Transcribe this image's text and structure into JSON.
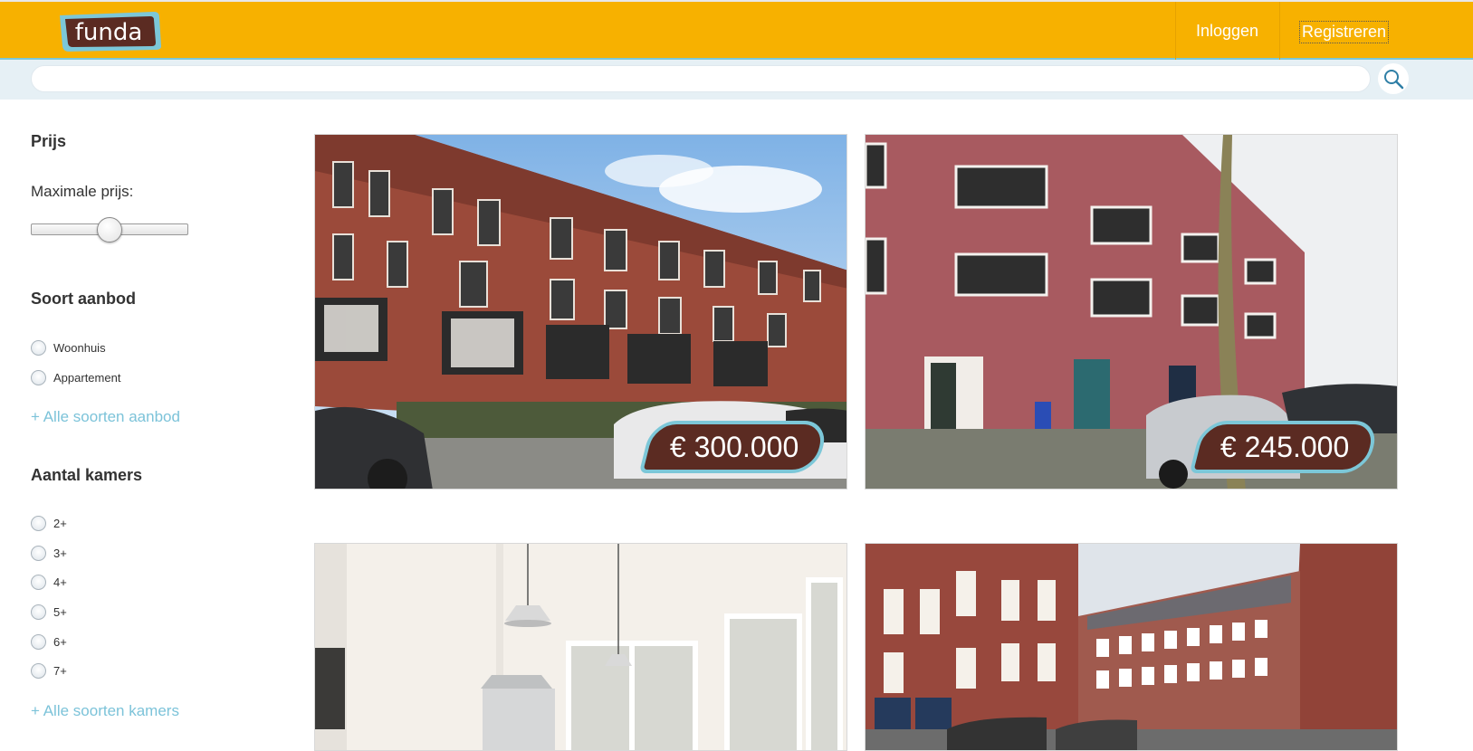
{
  "header": {
    "logo_text": "funda",
    "login_label": "Inloggen",
    "register_label": "Registreren"
  },
  "search": {
    "value": "",
    "placeholder": ""
  },
  "filters": {
    "price": {
      "heading": "Prijs",
      "max_label": "Maximale prijs:",
      "slider_level": 0.5
    },
    "offer_type": {
      "heading": "Soort aanbod",
      "options": [
        "Woonhuis",
        "Appartement"
      ],
      "more_link": "+ Alle soorten aanbod"
    },
    "rooms": {
      "heading": "Aantal kamers",
      "options": [
        "2+",
        "3+",
        "4+",
        "5+",
        "6+",
        "7+"
      ],
      "more_link": "+ Alle soorten kamers"
    }
  },
  "listings": [
    {
      "price": "€ 300.000"
    },
    {
      "price": "€ 245.000"
    },
    {
      "price": ""
    },
    {
      "price": ""
    }
  ],
  "colors": {
    "header": "#f7b100",
    "accent": "#7cc7d8",
    "price_badge": "#5b2b22",
    "link": "#7cc3d9"
  }
}
